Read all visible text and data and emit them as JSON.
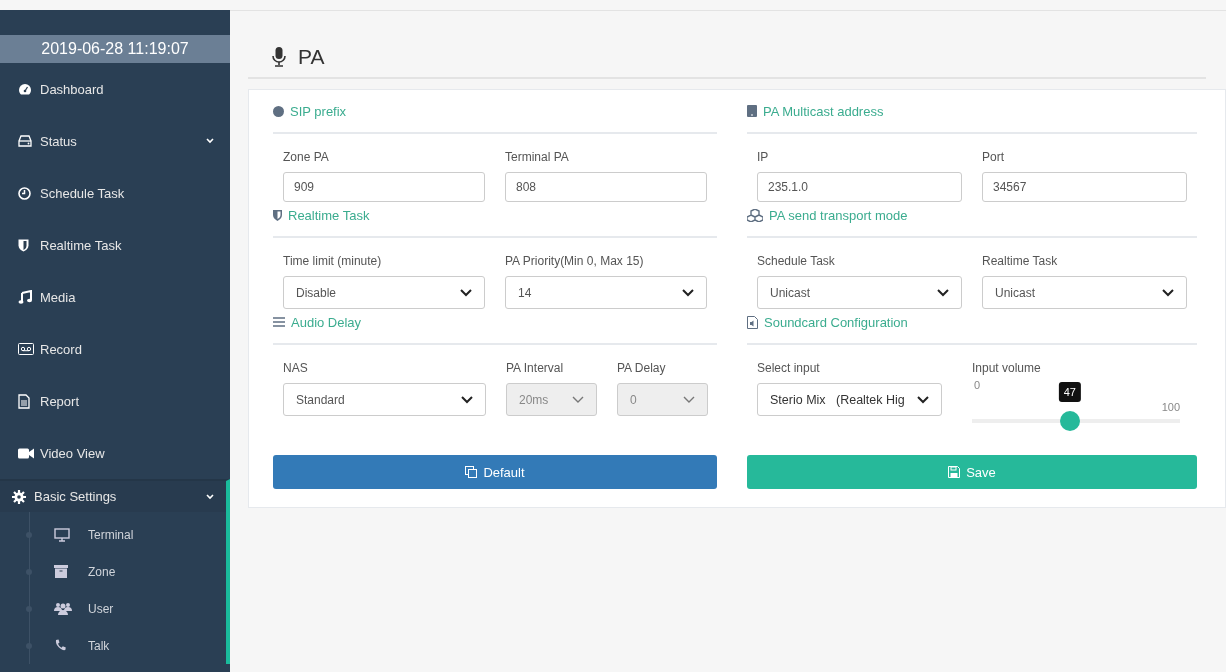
{
  "sidebar": {
    "datetime": "2019-06-28 11:19:07",
    "items": [
      {
        "label": "Dashboard",
        "selected": false
      },
      {
        "label": "Status",
        "selected": false,
        "has_submenu": true
      },
      {
        "label": "Schedule Task",
        "selected": false
      },
      {
        "label": "Realtime Task",
        "selected": false
      },
      {
        "label": "Media",
        "selected": false
      },
      {
        "label": "Record",
        "selected": false
      },
      {
        "label": "Report",
        "selected": false
      },
      {
        "label": "Video View",
        "selected": false
      },
      {
        "label": "Basic Settings",
        "selected": true,
        "has_submenu": true,
        "expanded": true,
        "children": [
          {
            "label": "Terminal"
          },
          {
            "label": "Zone"
          },
          {
            "label": "User"
          },
          {
            "label": "Talk"
          }
        ]
      }
    ]
  },
  "page": {
    "title": "PA"
  },
  "sections": [
    {
      "title": "SIP prefix",
      "fields": [
        {
          "kind": "input",
          "label": "Zone PA",
          "value": "909"
        },
        {
          "kind": "input",
          "label": "Terminal PA",
          "value": "808"
        }
      ]
    },
    {
      "title": "PA Multicast address",
      "fields": [
        {
          "kind": "input",
          "label": "IP",
          "value": "235.1.0"
        },
        {
          "kind": "input",
          "label": "Port",
          "value": "34567"
        }
      ]
    },
    {
      "title": "Realtime Task",
      "fields": [
        {
          "kind": "select",
          "label": "Time limit (minute)",
          "value": "Disable",
          "disabled": false
        },
        {
          "kind": "select",
          "label": "PA Priority(Min 0, Max 15)",
          "value": "14",
          "disabled": false
        }
      ]
    },
    {
      "title": "PA send transport mode",
      "fields": [
        {
          "kind": "select",
          "label": "Schedule Task",
          "value": "Unicast",
          "disabled": false
        },
        {
          "kind": "select",
          "label": "Realtime Task",
          "value": "Unicast",
          "disabled": false
        }
      ]
    },
    {
      "title": "Audio Delay",
      "fields": [
        {
          "kind": "select",
          "label": "NAS",
          "value": "Standard",
          "disabled": false
        },
        {
          "kind": "select",
          "label": "PA Interval",
          "value": "20ms",
          "disabled": true
        },
        {
          "kind": "select",
          "label": "PA Delay",
          "value": "0",
          "disabled": true
        }
      ]
    },
    {
      "title": "Soundcard Configuration",
      "fields": [
        {
          "kind": "select",
          "label": "Select input",
          "value": "Sterio Mix   (Realtek Hig",
          "disabled": false
        },
        {
          "kind": "slider",
          "label": "Input volume",
          "min": "0",
          "max": "100",
          "reading": "47",
          "level": 0.47
        }
      ]
    }
  ],
  "buttons": [
    {
      "label": "Default",
      "kind": "default"
    },
    {
      "label": "Save",
      "kind": "save"
    }
  ]
}
